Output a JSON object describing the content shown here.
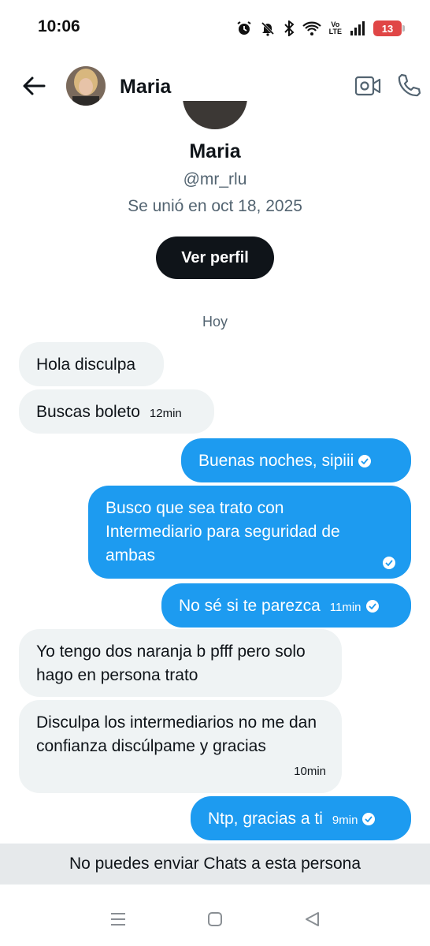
{
  "status_bar": {
    "time": "10:06",
    "battery": "13",
    "network": "Vo LTE"
  },
  "header": {
    "name": "Maria"
  },
  "profile": {
    "name": "Maria",
    "handle": "@mr_rlu",
    "joined": "Se unió en oct 18, 2025",
    "view_profile_label": "Ver perfil"
  },
  "day_separator": "Hoy",
  "messages": [
    {
      "direction": "incoming",
      "text": "Hola disculpa",
      "time": ""
    },
    {
      "direction": "incoming",
      "text": "Buscas boleto",
      "time": "12min"
    },
    {
      "direction": "outgoing",
      "text": "Buenas noches, sipiii",
      "time": ""
    },
    {
      "direction": "outgoing",
      "text": "Busco que sea trato con Intermediario para seguridad de ambas",
      "time": ""
    },
    {
      "direction": "outgoing",
      "text": "No sé si te parezca",
      "time": "11min"
    },
    {
      "direction": "incoming",
      "text": "Yo tengo dos naranja b pfff pero solo hago en persona trato",
      "time": ""
    },
    {
      "direction": "incoming",
      "text": "Disculpa los intermediarios no me dan confianza discúlpame y gracias",
      "time": "10min"
    },
    {
      "direction": "outgoing",
      "text": "Ntp, gracias a ti",
      "time": "9min"
    }
  ],
  "notice": "No puedes enviar Chats a esta persona",
  "colors": {
    "accent": "#1d9bf0",
    "incoming_bubble": "#eff3f4",
    "battery_low": "#e04646"
  }
}
